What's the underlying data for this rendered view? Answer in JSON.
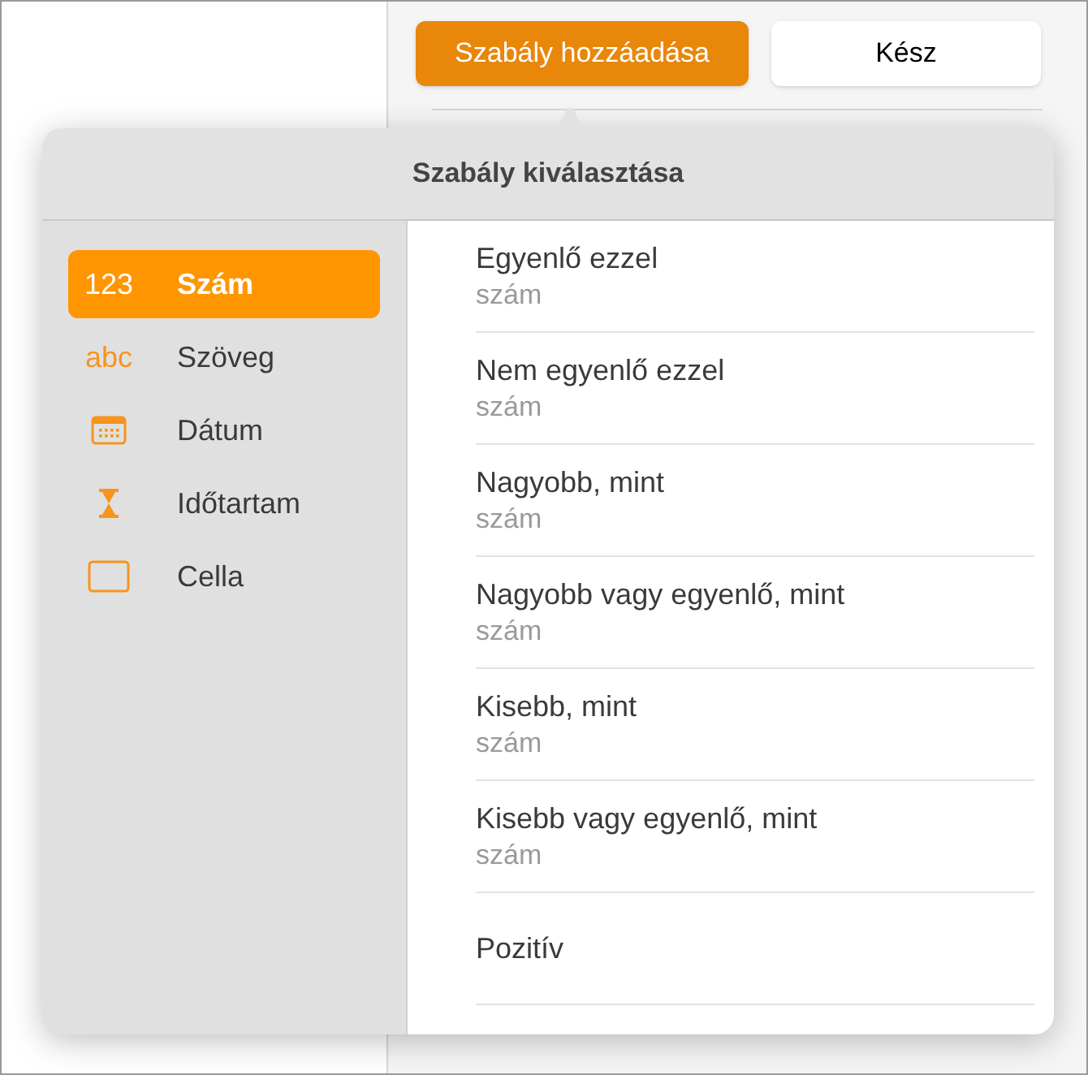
{
  "toolbar": {
    "add_rule": "Szabály hozzáadása",
    "done": "Kész"
  },
  "popover": {
    "title": "Szabály kiválasztása",
    "categories": [
      {
        "kind": "glyph",
        "glyph": "123",
        "label": "Szám",
        "selected": true
      },
      {
        "kind": "glyph",
        "glyph": "abc",
        "label": "Szöveg",
        "selected": false
      },
      {
        "kind": "calendar",
        "label": "Dátum",
        "selected": false
      },
      {
        "kind": "hourglass",
        "label": "Időtartam",
        "selected": false
      },
      {
        "kind": "cell",
        "label": "Cella",
        "selected": false
      }
    ],
    "rules": [
      {
        "title": "Egyenlő ezzel",
        "subtitle": "szám"
      },
      {
        "title": "Nem egyenlő ezzel",
        "subtitle": "szám"
      },
      {
        "title": "Nagyobb, mint",
        "subtitle": "szám"
      },
      {
        "title": "Nagyobb vagy egyenlő, mint",
        "subtitle": "szám"
      },
      {
        "title": "Kisebb, mint",
        "subtitle": "szám"
      },
      {
        "title": "Kisebb vagy egyenlő, mint",
        "subtitle": "szám"
      },
      {
        "title": "Pozitív"
      }
    ]
  }
}
